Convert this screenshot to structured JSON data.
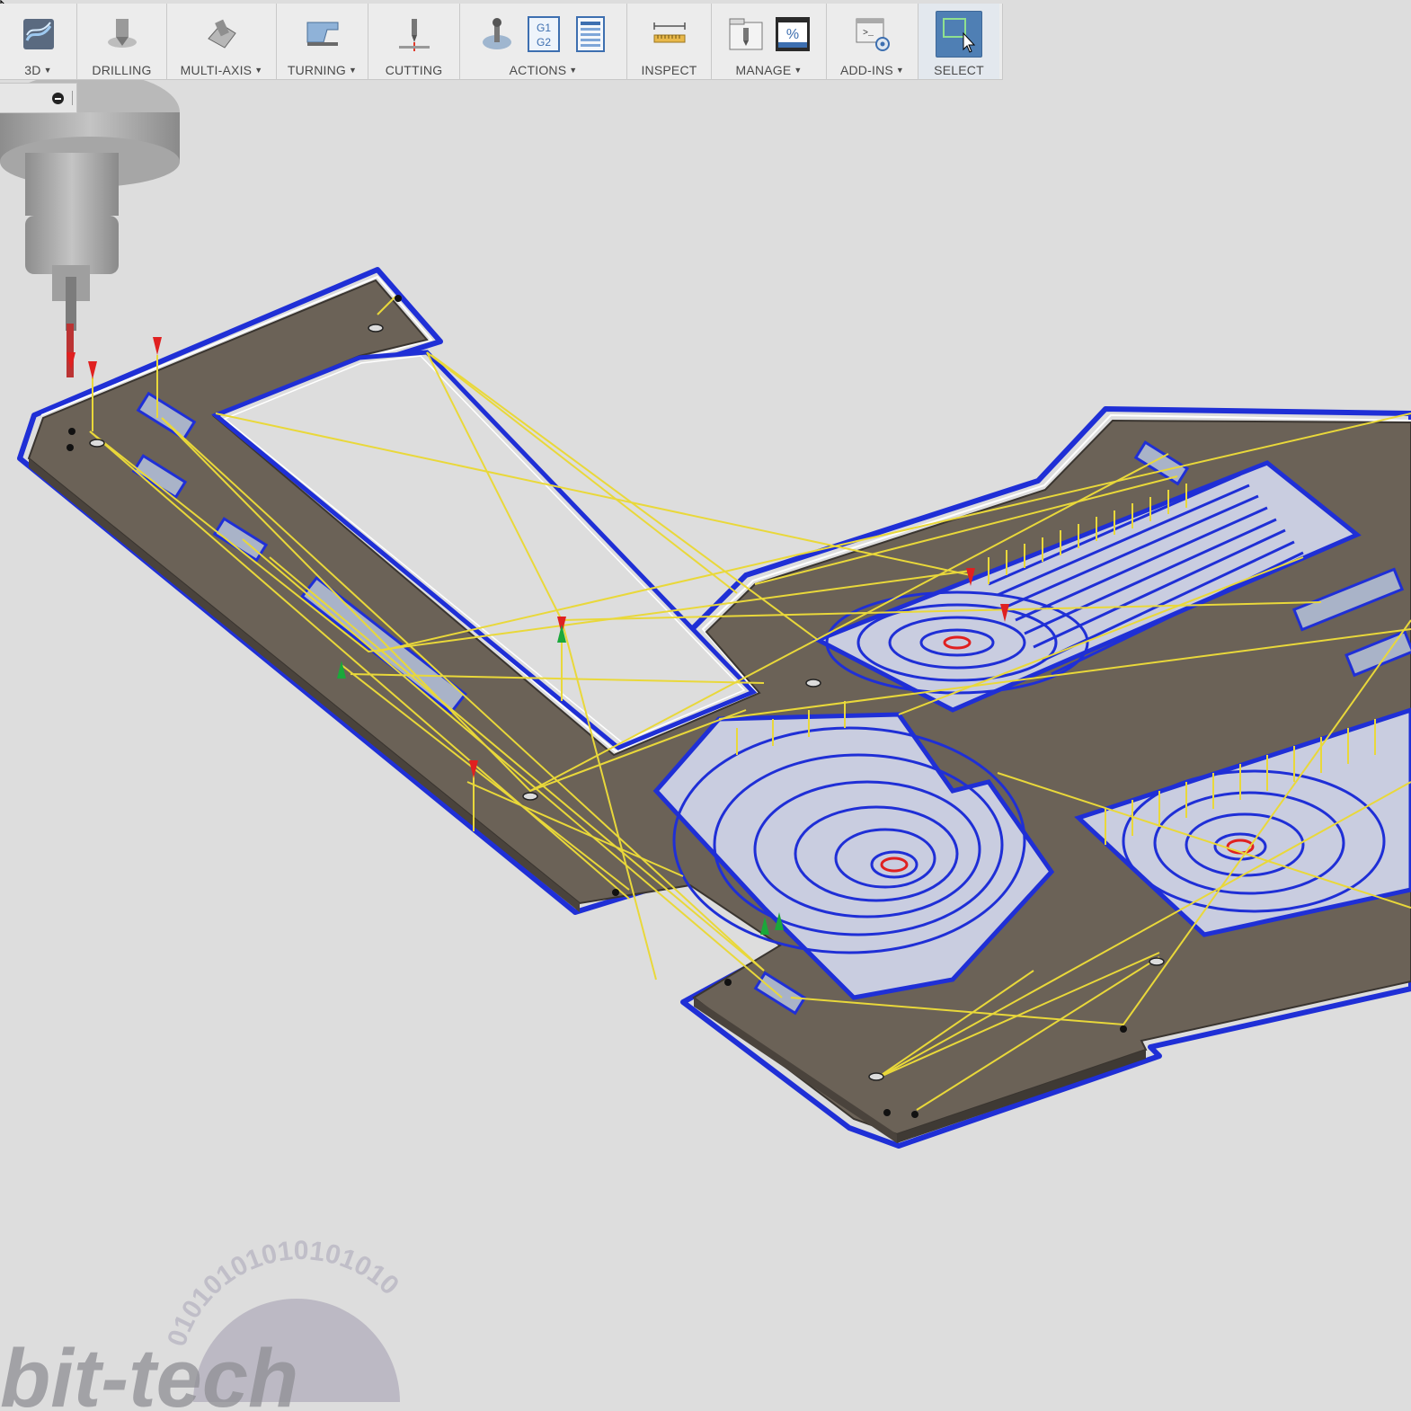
{
  "toolbar": {
    "groups": [
      {
        "label": "3D",
        "dropdown": true,
        "icon": "3d-milling-icon"
      },
      {
        "label": "DRILLING",
        "dropdown": false,
        "icon": "drill-icon"
      },
      {
        "label": "MULTI-AXIS",
        "dropdown": true,
        "icon": "multi-axis-icon"
      },
      {
        "label": "TURNING",
        "dropdown": true,
        "icon": "turning-icon"
      },
      {
        "label": "CUTTING",
        "dropdown": false,
        "icon": "cutting-icon"
      },
      {
        "label": "ACTIONS",
        "dropdown": true,
        "icon": "actions-icons",
        "g_code_label": "G1\nG2"
      },
      {
        "label": "INSPECT",
        "dropdown": false,
        "icon": "ruler-icon"
      },
      {
        "label": "MANAGE",
        "dropdown": true,
        "icon": "manage-icons",
        "percent_label": "%"
      },
      {
        "label": "ADD-INS",
        "dropdown": true,
        "icon": "scripts-gear-icon"
      },
      {
        "label": "SELECT",
        "dropdown": false,
        "icon": "select-cursor-icon"
      }
    ]
  },
  "viewport": {
    "toolpath_colors": {
      "boundary": "#1f2fd6",
      "rapid_moves": "#e9d83a",
      "entry": "#e02020",
      "leadin": "#1aa83a",
      "stock": "#6b6257"
    }
  },
  "watermark": {
    "text": "bit-tech",
    "binary_ring": "01010101010101010"
  }
}
